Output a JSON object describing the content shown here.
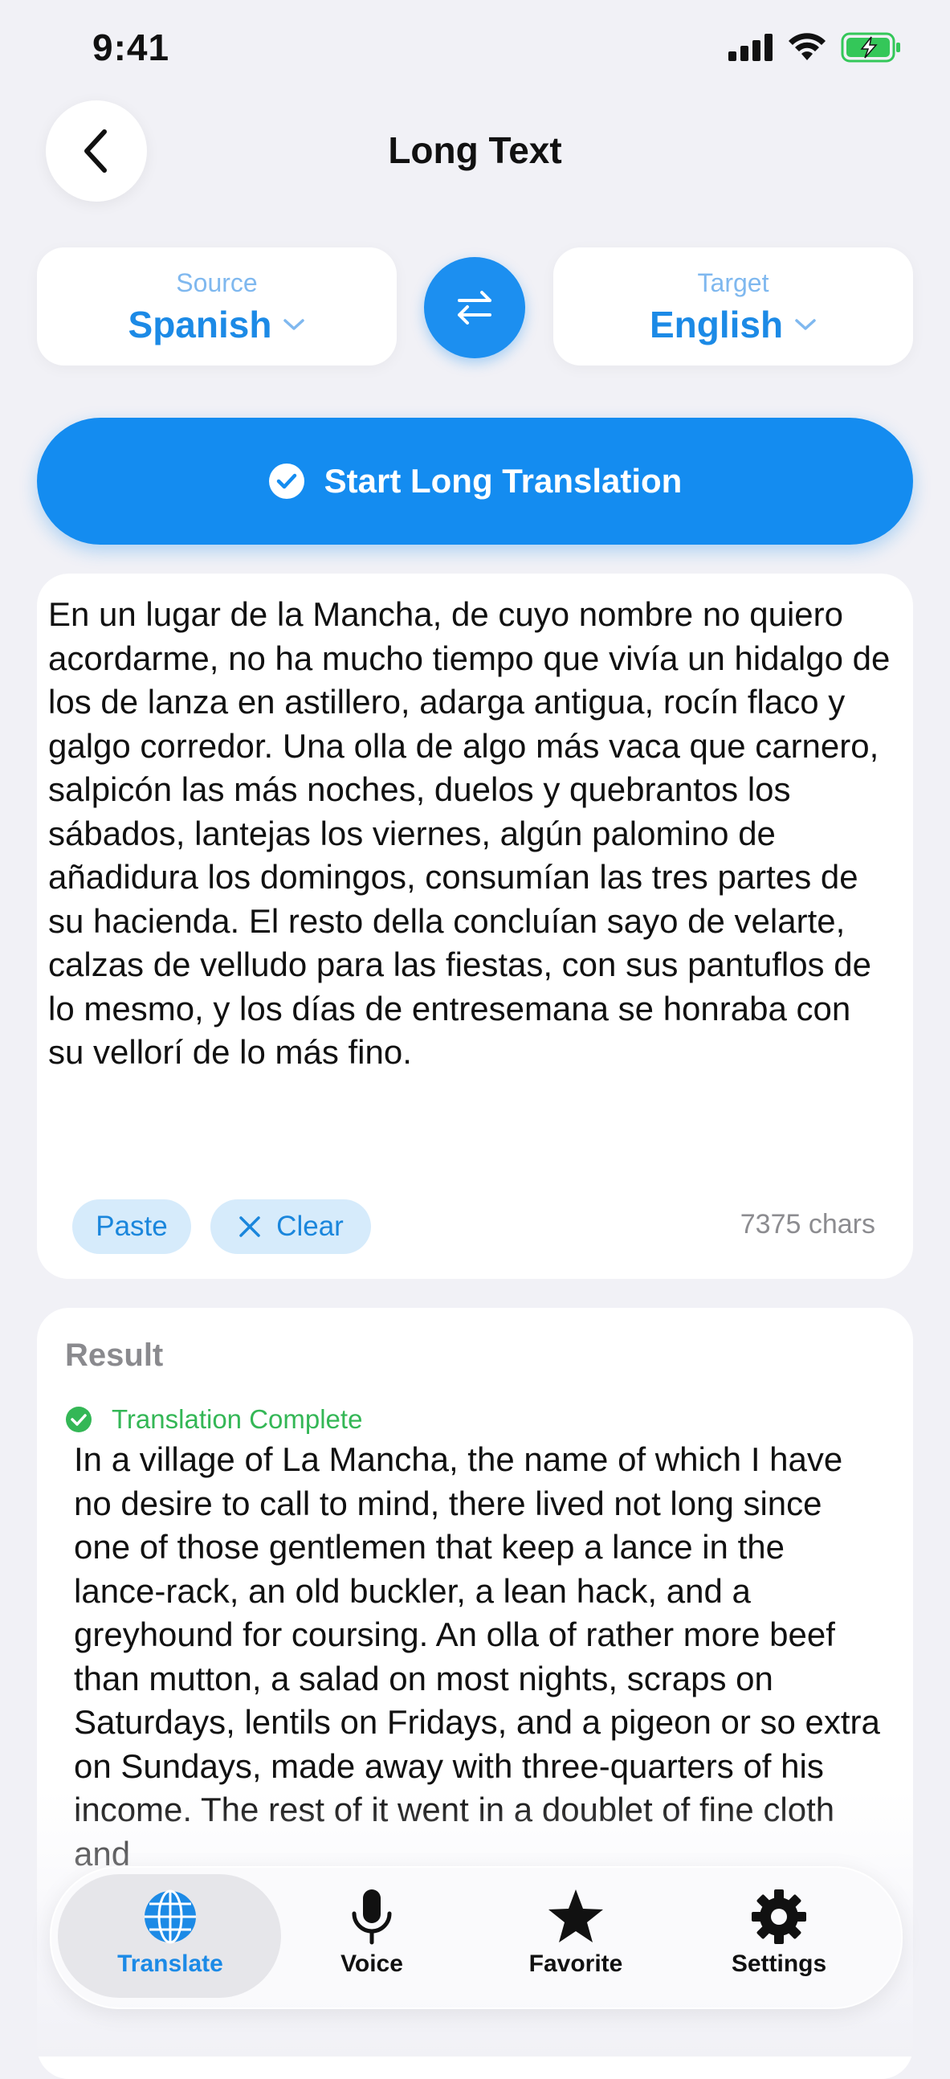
{
  "status_bar": {
    "time": "9:41"
  },
  "header": {
    "title": "Long Text"
  },
  "languages": {
    "source_label": "Source",
    "source_value": "Spanish",
    "target_label": "Target",
    "target_value": "English"
  },
  "start_button": {
    "label": "Start Long Translation"
  },
  "input": {
    "text": "En un lugar de la Mancha, de cuyo nombre no quiero acordarme, no ha mucho tiempo que vivía un hidalgo de los de lanza en astillero, adarga antigua, rocín flaco y galgo corredor. Una olla de algo más vaca que carnero, salpicón las más noches, duelos y quebrantos los sábados, lantejas los viernes, algún palomino de añadidura los domingos, consumían las tres partes de su hacienda. El resto della concluían sayo de velarte, calzas de velludo para las fiestas, con sus pantuflos de lo mesmo, y los días de entresemana se honraba con su vellorí de lo más fino.",
    "paste_label": "Paste",
    "clear_label": "Clear",
    "char_count": "7375 chars"
  },
  "result": {
    "title": "Result",
    "status": "Translation Complete",
    "text": "In a village of La Mancha, the name of which I have no desire to call to mind, there lived not long since one of those gentlemen that keep a lance in the lance-rack, an old buckler, a lean hack, and a greyhound for coursing. An olla of rather more beef than mutton, a salad on most nights, scraps on Saturdays, lentils on Fridays, and a pigeon or so extra on Sundays, made away with three-quarters of his income. The rest of it went in a doublet of fine cloth and"
  },
  "tabs": [
    {
      "label": "Translate",
      "icon": "globe-icon",
      "active": true
    },
    {
      "label": "Voice",
      "icon": "microphone-icon",
      "active": false
    },
    {
      "label": "Favorite",
      "icon": "star-icon",
      "active": false
    },
    {
      "label": "Settings",
      "icon": "gear-icon",
      "active": false
    }
  ],
  "colors": {
    "accent": "#148cf0",
    "success": "#34b756",
    "background": "#f1f1f6",
    "battery": "#34c759"
  }
}
